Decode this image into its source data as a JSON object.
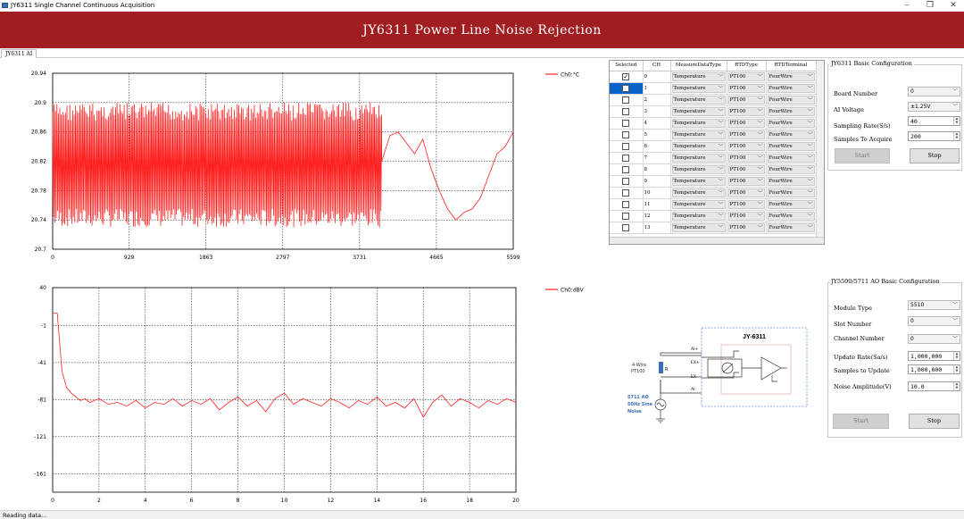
{
  "window": {
    "title": "JY6311 Single Channel Continuous Acquisition",
    "minimize": "–",
    "maximize": "❐",
    "close": "✕"
  },
  "banner": {
    "title": "JY6311 Power Line Noise Rejection"
  },
  "tabs": [
    {
      "label": "JY6311 AI"
    }
  ],
  "status": {
    "text": "Reading data..."
  },
  "colors": {
    "accent": "#a01d21",
    "series": "#ff2020",
    "selection": "#0a64c8"
  },
  "chart_data": [
    {
      "type": "line",
      "xlim": [
        0,
        5599
      ],
      "ylim": [
        20.7,
        20.94
      ],
      "x_ticks": [
        0,
        929,
        1863,
        2797,
        3731,
        4665,
        5599
      ],
      "y_ticks": [
        20.7,
        20.74,
        20.78,
        20.82,
        20.86,
        20.9,
        20.94
      ],
      "x_tick_labels": [
        "0",
        "929",
        "1863",
        "2797",
        "3731",
        "4665",
        "5599"
      ],
      "y_tick_labels": [
        "20.7",
        "20.74",
        "20.78",
        "20.82",
        "20.86",
        "20.9",
        "20.94"
      ],
      "grid": true,
      "legend_position": "right",
      "series": [
        {
          "name": "Ch0:°C",
          "noise_band": {
            "x_range": [
              0,
              4000
            ],
            "y_range": [
              20.73,
              20.9
            ]
          },
          "x": [
            4000,
            4100,
            4200,
            4300,
            4400,
            4500,
            4600,
            4700,
            4800,
            4900,
            5000,
            5100,
            5200,
            5300,
            5400,
            5500,
            5599
          ],
          "values": [
            20.82,
            20.855,
            20.86,
            20.845,
            20.83,
            20.85,
            20.81,
            20.78,
            20.755,
            20.74,
            20.75,
            20.755,
            20.77,
            20.8,
            20.83,
            20.84,
            20.86
          ]
        }
      ]
    },
    {
      "type": "line",
      "xlim": [
        0,
        20
      ],
      "ylim": [
        -181,
        40
      ],
      "x_ticks": [
        0,
        2,
        4,
        6,
        8,
        10,
        12,
        14,
        16,
        18,
        20
      ],
      "y_ticks": [
        40,
        -1,
        -41,
        -81,
        -121,
        -161
      ],
      "x_tick_labels": [
        "0",
        "2",
        "4",
        "6",
        "8",
        "10",
        "12",
        "14",
        "16",
        "18",
        "20"
      ],
      "y_tick_labels": [
        "40",
        "-1",
        "-41",
        "-81",
        "-121",
        "-161"
      ],
      "grid": true,
      "legend_position": "right",
      "series": [
        {
          "name": "Ch0:dBV",
          "x": [
            0,
            0.2,
            0.4,
            0.6,
            0.8,
            1,
            1.2,
            1.4,
            1.6,
            1.8,
            2,
            2.4,
            2.8,
            3.2,
            3.6,
            4,
            4.4,
            4.8,
            5.2,
            5.6,
            6,
            6.4,
            6.8,
            7.2,
            7.6,
            8,
            8.4,
            8.8,
            9.2,
            9.6,
            10,
            10.4,
            10.8,
            11.2,
            11.6,
            12,
            12.4,
            12.8,
            13.2,
            13.6,
            14,
            14.4,
            14.8,
            15.2,
            15.6,
            16,
            16.4,
            16.8,
            17.2,
            17.6,
            18,
            18.4,
            18.8,
            19.2,
            19.6,
            20
          ],
          "values": [
            13,
            12,
            -50,
            -68,
            -74,
            -78,
            -82,
            -80,
            -84,
            -82,
            -80,
            -86,
            -84,
            -88,
            -82,
            -90,
            -84,
            -86,
            -80,
            -88,
            -82,
            -86,
            -80,
            -92,
            -84,
            -78,
            -88,
            -82,
            -94,
            -80,
            -74,
            -86,
            -80,
            -84,
            -88,
            -80,
            -84,
            -90,
            -82,
            -86,
            -78,
            -88,
            -84,
            -90,
            -80,
            -100,
            -84,
            -76,
            -88,
            -80,
            -84,
            -90,
            -82,
            -86,
            -80,
            -84
          ]
        }
      ]
    }
  ],
  "grid": {
    "headers": [
      "Selected",
      "CH",
      "MeasureDataType",
      "RTDType",
      "RTDTerminal"
    ],
    "rows": [
      {
        "ch": "0",
        "type": "Temperature",
        "rtd": "PT100",
        "term": "FourWire",
        "checked": true
      },
      {
        "ch": "1",
        "type": "Temperature",
        "rtd": "PT100",
        "term": "FourWire",
        "checked": false,
        "highlight": true
      },
      {
        "ch": "2",
        "type": "Temperature",
        "rtd": "PT100",
        "term": "FourWire",
        "checked": false
      },
      {
        "ch": "3",
        "type": "Temperature",
        "rtd": "PT100",
        "term": "FourWire",
        "checked": false
      },
      {
        "ch": "4",
        "type": "Temperature",
        "rtd": "PT100",
        "term": "FourWire",
        "checked": false
      },
      {
        "ch": "5",
        "type": "Temperature",
        "rtd": "PT100",
        "term": "FourWire",
        "checked": false
      },
      {
        "ch": "6",
        "type": "Temperature",
        "rtd": "PT100",
        "term": "FourWire",
        "checked": false
      },
      {
        "ch": "7",
        "type": "Temperature",
        "rtd": "PT100",
        "term": "FourWire",
        "checked": false
      },
      {
        "ch": "8",
        "type": "Temperature",
        "rtd": "PT100",
        "term": "FourWire",
        "checked": false
      },
      {
        "ch": "9",
        "type": "Temperature",
        "rtd": "PT100",
        "term": "FourWire",
        "checked": false
      },
      {
        "ch": "10",
        "type": "Temperature",
        "rtd": "PT100",
        "term": "FourWire",
        "checked": false
      },
      {
        "ch": "11",
        "type": "Temperature",
        "rtd": "PT100",
        "term": "FourWire",
        "checked": false
      },
      {
        "ch": "12",
        "type": "Temperature",
        "rtd": "PT100",
        "term": "FourWire",
        "checked": false
      },
      {
        "ch": "13",
        "type": "Temperature",
        "rtd": "PT100",
        "term": "FourWire",
        "checked": false
      }
    ]
  },
  "ai_config": {
    "title": "JY6311 Basic Configuration",
    "board_number_label": "Board Number",
    "board_number": "0",
    "ai_voltage_label": "AI Voltage",
    "ai_voltage": "±1.25V",
    "sampling_rate_label": "Sampling Rate(S/s)",
    "sampling_rate": "40",
    "samples_label": "Samples To Acquire",
    "samples": "200",
    "start": "Start",
    "stop": "Stop"
  },
  "ao_config": {
    "title": "JY5500/5711 AO Basic Configuration",
    "module_type_label": "Module Type",
    "module_type": "5510",
    "slot_number_label": "Slot Number",
    "slot_number": "0",
    "channel_number_label": "Channel Number",
    "channel_number": "0",
    "update_rate_label": "Update Rate(Sa/s)",
    "update_rate": "1,000,000",
    "samples_update_label": "Samples to Update",
    "samples_update": "1,000,000",
    "noise_amp_label": "Noise Amplitude(V)",
    "noise_amp": "10.0",
    "start": "Start",
    "stop": "Stop"
  },
  "diagram": {
    "device": "JY-6311",
    "sensor": [
      "4-Wire",
      "PT100"
    ],
    "resistor": "R",
    "source": [
      "5711 AO",
      "50Hz Sine",
      "Noise"
    ],
    "pins": [
      "AI+",
      "EX+",
      "EX-",
      "AI-"
    ]
  }
}
